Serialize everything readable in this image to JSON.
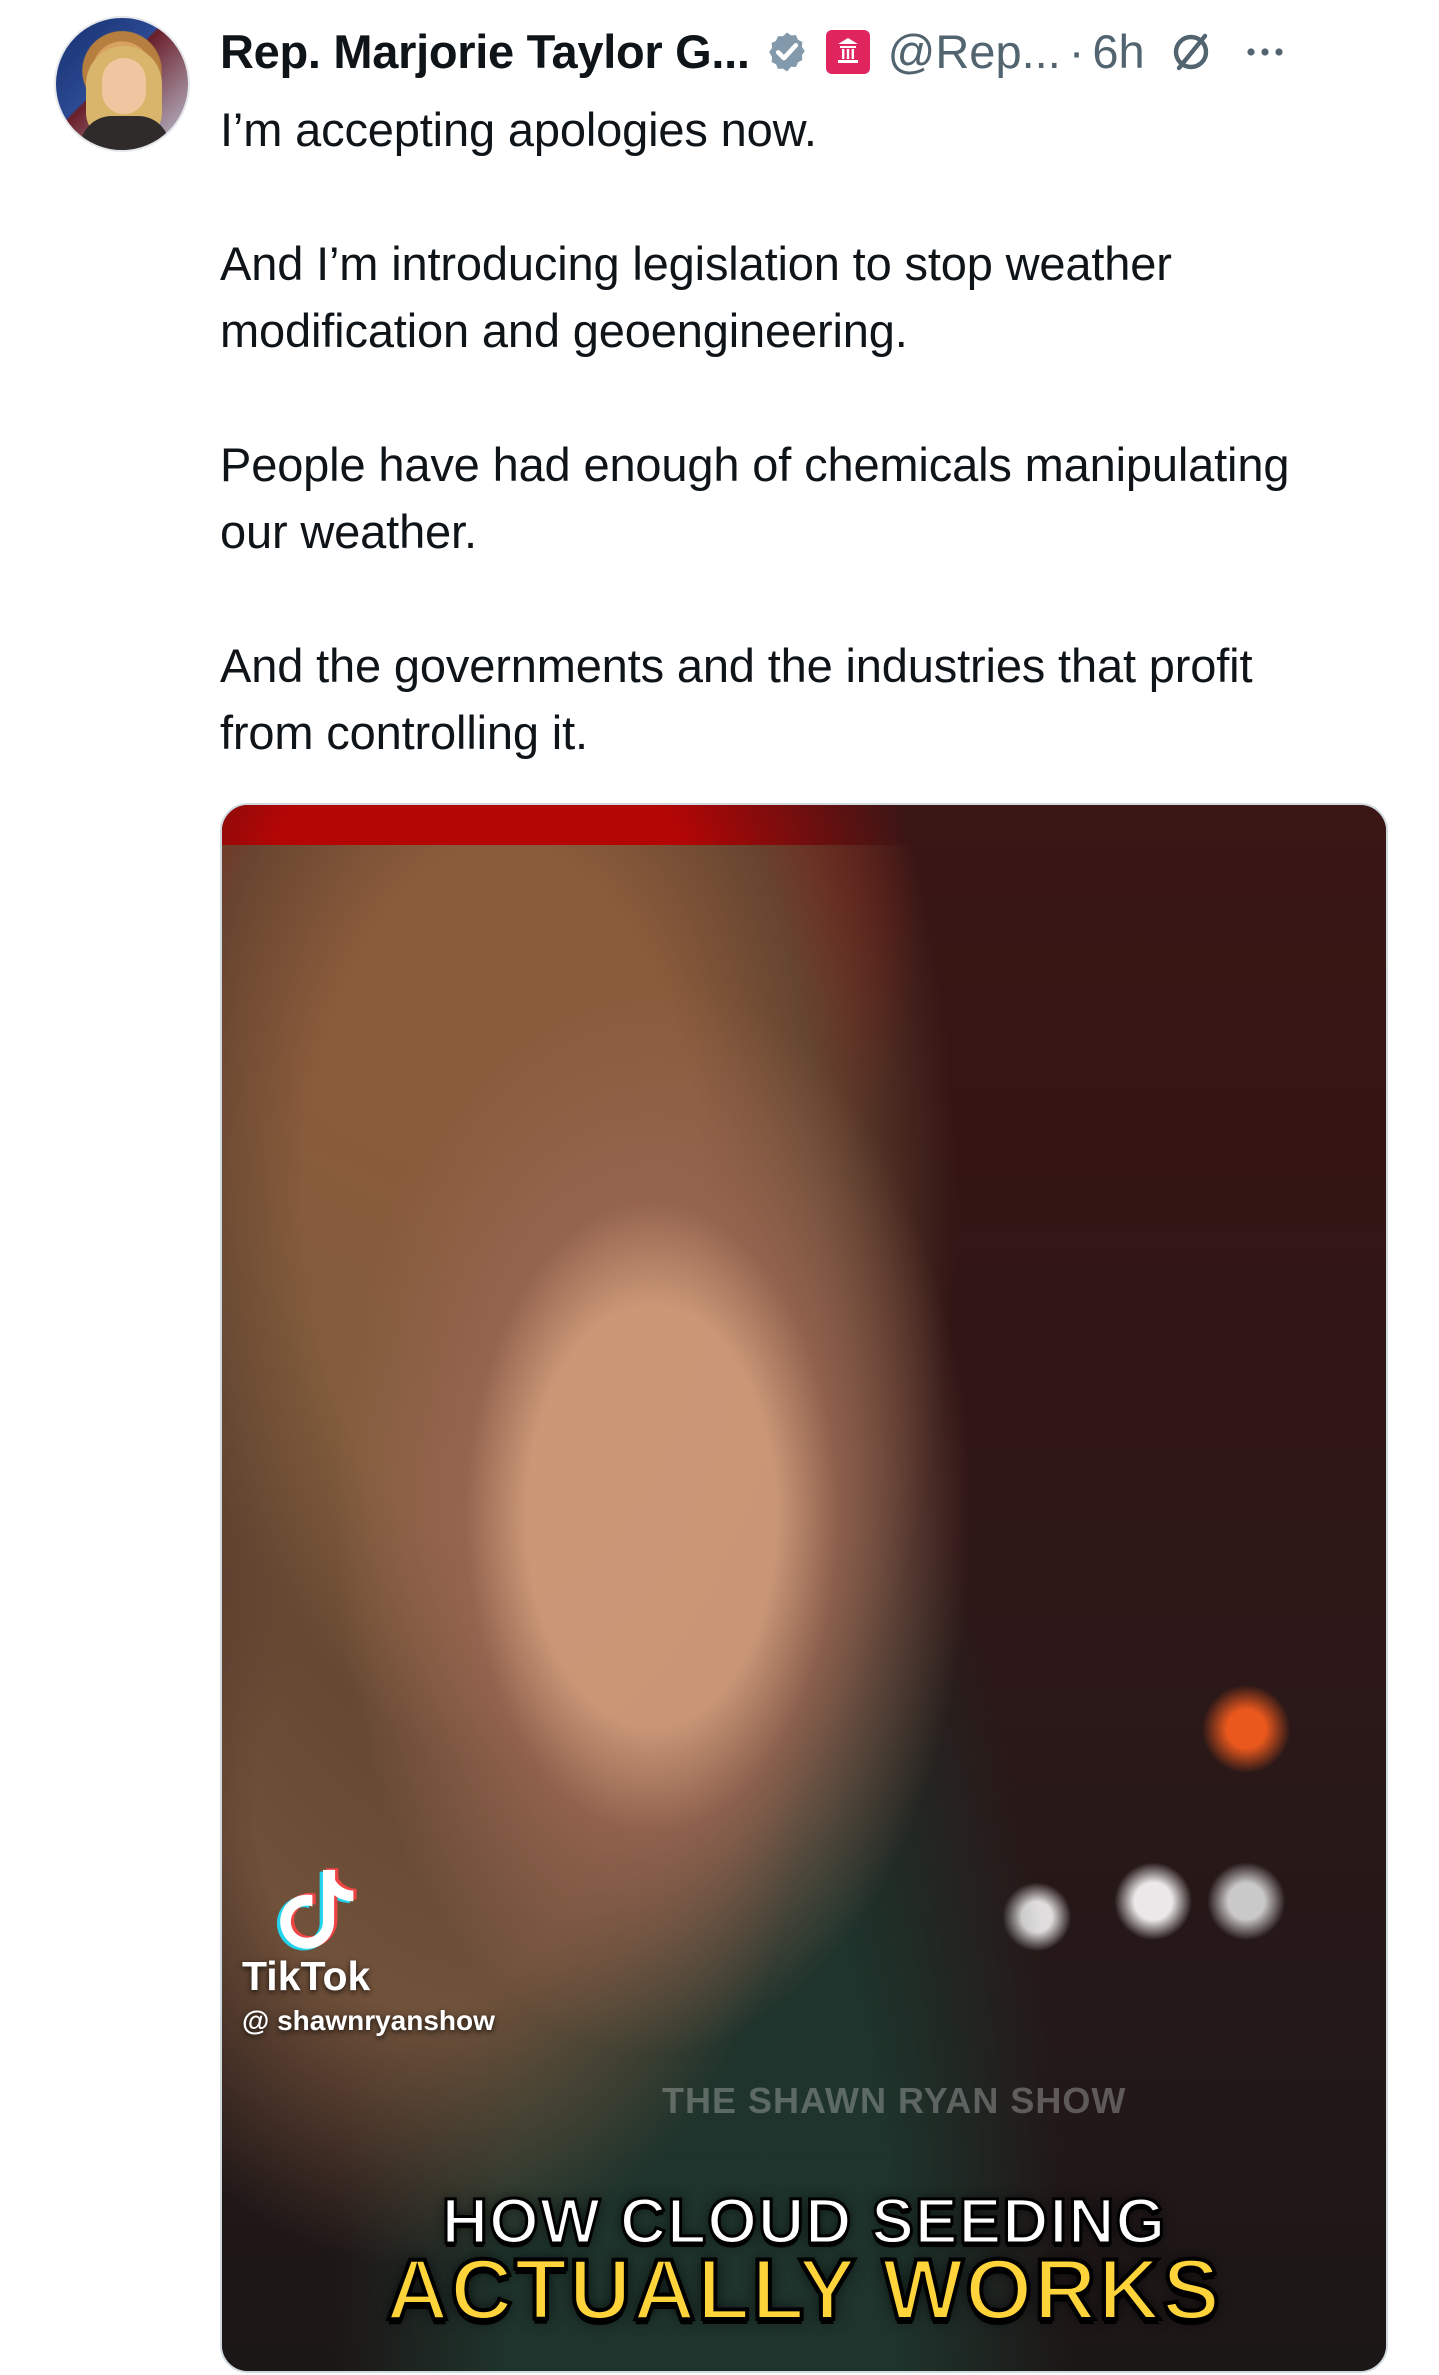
{
  "tweet": {
    "display_name": "Rep. Marjorie Taylor G...",
    "handle": "@Rep...",
    "separator": "·",
    "timestamp": "6h",
    "paragraphs": [
      "I’m accepting apologies now.",
      "And I’m introducing legislation to stop weather\nmodification and geoengineering.",
      "People have had enough of chemicals manipulating\nour weather.",
      "And the governments and the industries that profit\nfrom controlling it."
    ]
  },
  "media": {
    "tiktok_label": "TikTok",
    "tiktok_handle": "@ shawnryanshow",
    "watermark": "THE SHAWN RYAN SHOW",
    "caption_line_1": "HOW CLOUD SEEDING",
    "caption_line_2": "ACTUALLY WORKS"
  },
  "icons": {
    "verified": "verified-badge-icon",
    "government": "government-label-icon",
    "grok": "grok-icon",
    "more": "more-options-icon",
    "tiktok": "tiktok-logo-icon"
  },
  "colors": {
    "text_primary": "#0f1419",
    "text_secondary": "#536471",
    "verified_blue": "#829aab",
    "government_red": "#e0245e",
    "caption_yellow": "#ffd43b"
  }
}
